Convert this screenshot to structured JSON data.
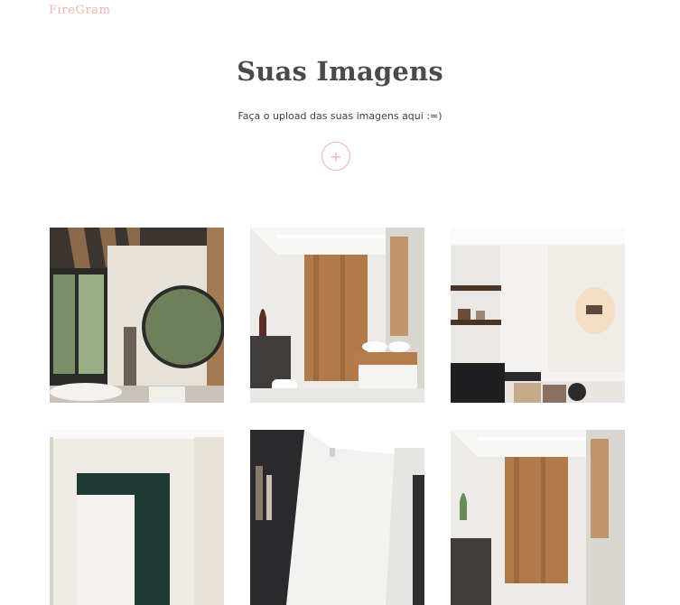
{
  "brand": "FireGram",
  "header": {
    "title": "Suas Imagens",
    "subtitle": "Faça o upload das suas imagens aqui :=)",
    "upload_label": "+"
  },
  "colors": {
    "accent": "#efb6b2",
    "text": "#4a4a4a"
  },
  "gallery": {
    "images": [
      {
        "scene": "bathroom-wood-beams-round-mirror"
      },
      {
        "scene": "bathroom-wood-wall-floating-vanity"
      },
      {
        "scene": "living-room-shelves-wall-light"
      },
      {
        "scene": "room-white-wall-dark-green-art"
      },
      {
        "scene": "room-dark-shelves-ceiling"
      },
      {
        "scene": "bathroom-wood-wall-floating-vanity"
      }
    ]
  }
}
